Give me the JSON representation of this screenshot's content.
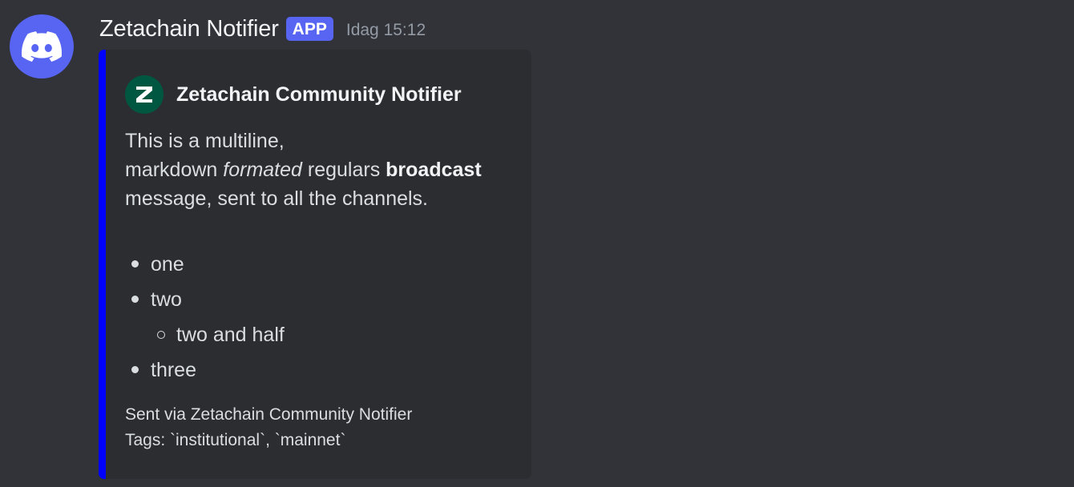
{
  "avatar": {
    "icon": "discord-logo-icon",
    "color": "#5865f2"
  },
  "header": {
    "username": "Zetachain Notifier",
    "badge": "APP",
    "timestamp": "Idag 15:12"
  },
  "embed": {
    "accent_color": "#0000ff",
    "author": {
      "icon": "zetachain-logo-icon",
      "name": "Zetachain Community Notifier"
    },
    "description": {
      "line1": "This is a multiline,",
      "line2_prefix": "markdown ",
      "line2_italic": "formated",
      "line2_middle": " regulars ",
      "line2_bold": "broadcast",
      "line3": "message, sent to all the channels."
    },
    "list": [
      {
        "text": "one",
        "level": 1
      },
      {
        "text": "two",
        "level": 1
      },
      {
        "text": "two and half",
        "level": 2
      },
      {
        "text": "three",
        "level": 1
      }
    ],
    "footer": {
      "line1": "Sent via Zetachain Community Notifier",
      "line2": "Tags: `institutional`, `mainnet`"
    }
  }
}
